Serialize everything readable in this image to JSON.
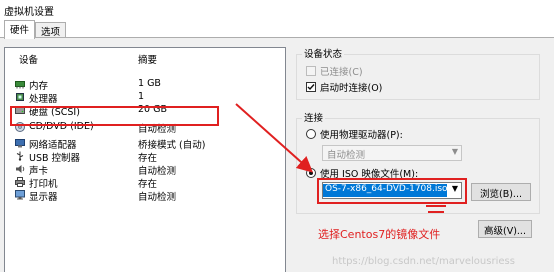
{
  "window": {
    "title": "虚拟机设置"
  },
  "tabs": [
    {
      "label": "硬件"
    },
    {
      "label": "选项"
    }
  ],
  "device_list": {
    "headers": {
      "device": "设备",
      "summary": "摘要"
    },
    "rows": [
      {
        "name": "内存",
        "summary": "1 GB",
        "icon": "memory-icon"
      },
      {
        "name": "处理器",
        "summary": "1",
        "icon": "processor-icon"
      },
      {
        "name": "硬盘 (SCSI)",
        "summary": "20 GB",
        "icon": "harddisk-icon"
      },
      {
        "name": "CD/DVD (IDE)",
        "summary": "自动检测",
        "icon": "cd-dvd-icon"
      },
      {
        "name": "网络适配器",
        "summary": "桥接模式 (自动)",
        "icon": "network-adapter-icon"
      },
      {
        "name": "USB 控制器",
        "summary": "存在",
        "icon": "usb-icon"
      },
      {
        "name": "声卡",
        "summary": "自动检测",
        "icon": "sound-card-icon"
      },
      {
        "name": "打印机",
        "summary": "存在",
        "icon": "printer-icon"
      },
      {
        "name": "显示器",
        "summary": "自动检测",
        "icon": "display-icon"
      }
    ]
  },
  "device_status": {
    "title": "设备状态",
    "connected": {
      "label": "已连接(C)",
      "checked": false
    },
    "connect_on_power": {
      "label": "启动时连接(O)",
      "checked": true
    }
  },
  "connection": {
    "title": "连接",
    "physical": {
      "label": "使用物理驱动器(P):",
      "selected": false,
      "value": "自动检测"
    },
    "iso": {
      "label": "使用 ISO 映像文件(M):",
      "selected": true,
      "value": "OS-7-x86_64-DVD-1708.iso"
    },
    "browse_label": "浏览(B)...",
    "advanced_label": "高级(V)..."
  },
  "annotation": {
    "text": "选择Centos7的镜像文件"
  },
  "watermark": "https://blog.csdn.net/marvelousriess",
  "colors": {
    "highlight_red": "#e02020",
    "selection_blue": "#0078d7"
  }
}
